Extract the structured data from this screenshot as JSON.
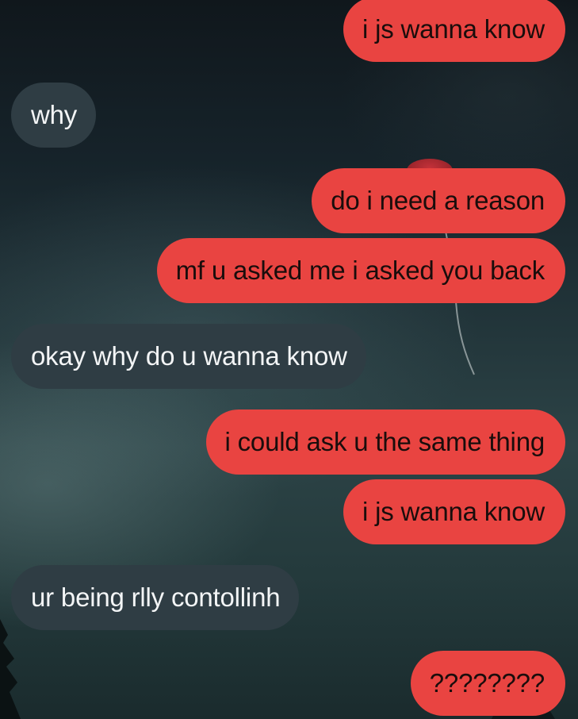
{
  "conversation": {
    "messages": [
      {
        "direction": "sent",
        "text": "i js wanna know"
      },
      {
        "direction": "received",
        "text": "why"
      },
      {
        "direction": "sent",
        "text": "do i need a reason"
      },
      {
        "direction": "sent",
        "text": "mf u asked me i asked you back"
      },
      {
        "direction": "received",
        "text": "okay why do u wanna know"
      },
      {
        "direction": "sent",
        "text": "i could ask u the same thing"
      },
      {
        "direction": "sent",
        "text": "i js wanna know"
      },
      {
        "direction": "received",
        "text": "ur being rlly contollinh"
      },
      {
        "direction": "sent",
        "text": "????????"
      }
    ]
  },
  "colors": {
    "sent_bubble": "#e94441",
    "received_bubble": "#2f3d44",
    "sent_text": "#1a0d0c",
    "received_text": "#f3f5f6"
  }
}
